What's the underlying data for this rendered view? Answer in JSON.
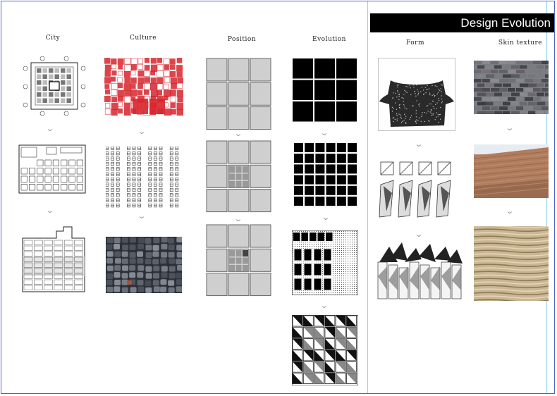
{
  "header": {
    "title": "Design Evolution"
  },
  "columns": [
    {
      "id": "city",
      "label": "City"
    },
    {
      "id": "culture",
      "label": "Culture"
    },
    {
      "id": "position",
      "label": "Position"
    },
    {
      "id": "evolution",
      "label": "Evolution"
    },
    {
      "id": "form",
      "label": "Form"
    },
    {
      "id": "skin",
      "label": "Skin texture"
    }
  ],
  "arrow_glyph": "⌄",
  "colors": {
    "accent_border": "#4e66c4",
    "guide_line": "#8fd6e6",
    "title_bar": "#000000",
    "grid_gray": "#cfcfcf",
    "grid_dark": "#444444",
    "culture_red": "#d8252e"
  }
}
